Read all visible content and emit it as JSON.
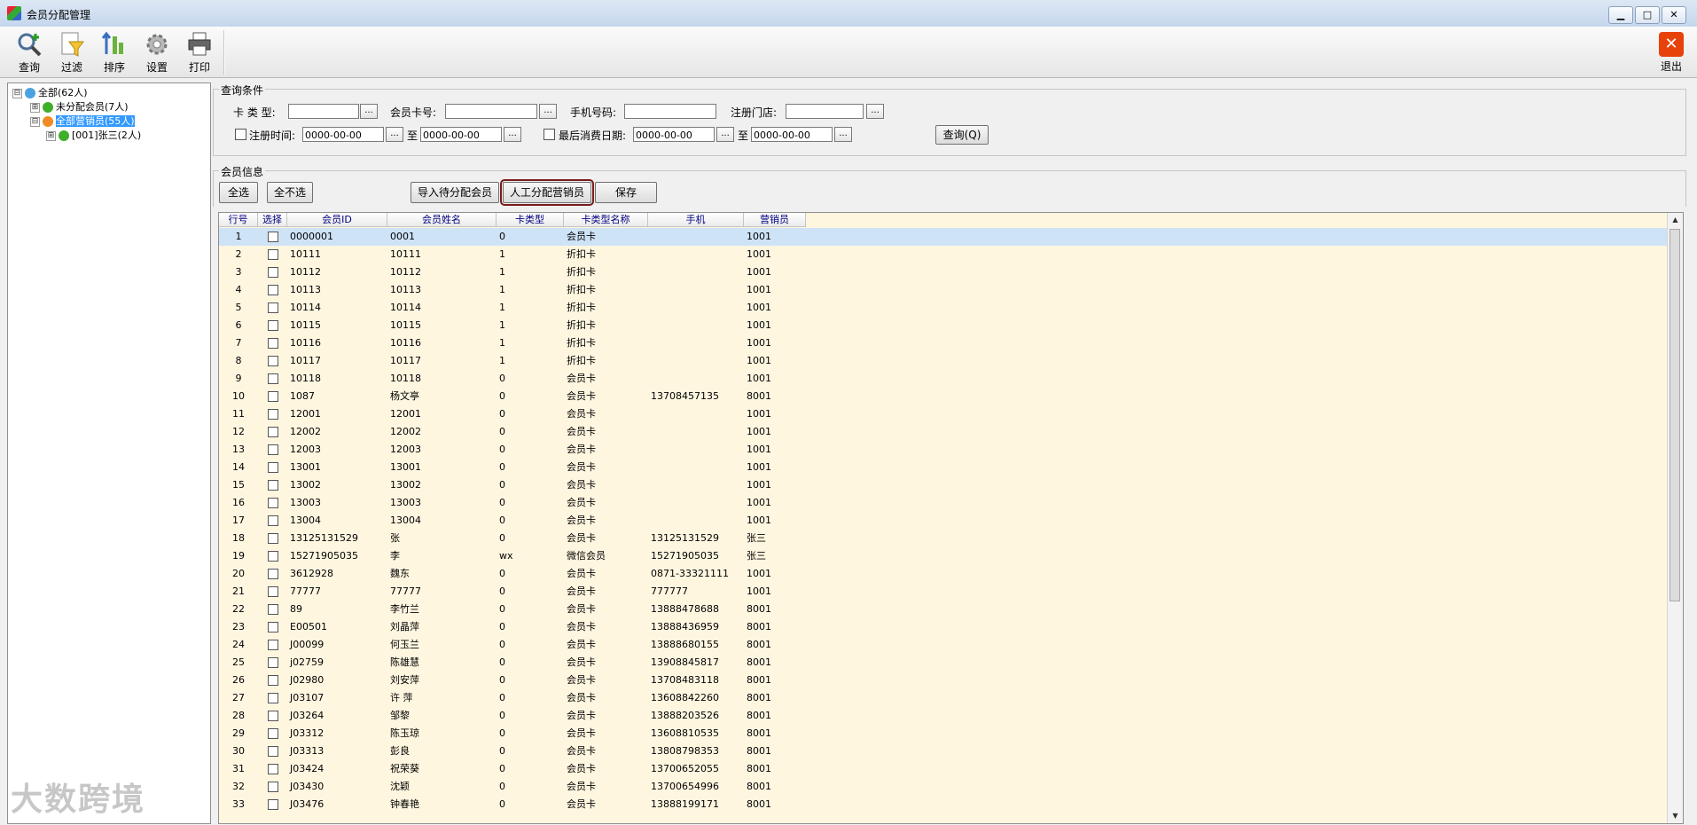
{
  "window": {
    "title": "会员分配管理",
    "min_label": "▁",
    "max_label": "□",
    "close_label": "✕"
  },
  "toolbar": {
    "query": "查询",
    "filter": "过滤",
    "sort": "排序",
    "settings": "设置",
    "print": "打印",
    "exit": "退出",
    "exit_icon": "✕"
  },
  "tree": {
    "root": "全部(62人)",
    "unassigned": "未分配会员(7人)",
    "all_sales": "全部营销员(55人)",
    "salesperson": "[001]张三(2人)"
  },
  "query": {
    "group_title": "查询条件",
    "card_type_label": "卡 类 型:",
    "card_no_label": "会员卡号:",
    "phone_label": "手机号码:",
    "store_label": "注册门店:",
    "reg_time_label": "注册时间:",
    "reg_from": "0000-00-00",
    "to_label": "至",
    "reg_to": "0000-00-00",
    "last_consume_label": "最后消费日期:",
    "consume_from": "0000-00-00",
    "consume_to": "0000-00-00",
    "dots": "...",
    "query_button": "查询(Q)"
  },
  "members": {
    "group_title": "会员信息",
    "select_all": "全选",
    "select_none": "全不选",
    "import_pending": "导入待分配会员",
    "manual_assign": "人工分配营销员",
    "save": "保存"
  },
  "grid": {
    "columns": [
      "行号",
      "选择",
      "会员ID",
      "会员姓名",
      "卡类型",
      "卡类型名称",
      "手机",
      "营销员"
    ],
    "rows": [
      [
        "1",
        "0000001",
        "0001",
        "0",
        "会员卡",
        "",
        "1001"
      ],
      [
        "2",
        "10111",
        "10111",
        "1",
        "折扣卡",
        "",
        "1001"
      ],
      [
        "3",
        "10112",
        "10112",
        "1",
        "折扣卡",
        "",
        "1001"
      ],
      [
        "4",
        "10113",
        "10113",
        "1",
        "折扣卡",
        "",
        "1001"
      ],
      [
        "5",
        "10114",
        "10114",
        "1",
        "折扣卡",
        "",
        "1001"
      ],
      [
        "6",
        "10115",
        "10115",
        "1",
        "折扣卡",
        "",
        "1001"
      ],
      [
        "7",
        "10116",
        "10116",
        "1",
        "折扣卡",
        "",
        "1001"
      ],
      [
        "8",
        "10117",
        "10117",
        "1",
        "折扣卡",
        "",
        "1001"
      ],
      [
        "9",
        "10118",
        "10118",
        "0",
        "会员卡",
        "",
        "1001"
      ],
      [
        "10",
        "1087",
        "杨文亭",
        "0",
        "会员卡",
        "13708457135",
        "8001"
      ],
      [
        "11",
        "12001",
        "12001",
        "0",
        "会员卡",
        "",
        "1001"
      ],
      [
        "12",
        "12002",
        "12002",
        "0",
        "会员卡",
        "",
        "1001"
      ],
      [
        "13",
        "12003",
        "12003",
        "0",
        "会员卡",
        "",
        "1001"
      ],
      [
        "14",
        "13001",
        "13001",
        "0",
        "会员卡",
        "",
        "1001"
      ],
      [
        "15",
        "13002",
        "13002",
        "0",
        "会员卡",
        "",
        "1001"
      ],
      [
        "16",
        "13003",
        "13003",
        "0",
        "会员卡",
        "",
        "1001"
      ],
      [
        "17",
        "13004",
        "13004",
        "0",
        "会员卡",
        "",
        "1001"
      ],
      [
        "18",
        "13125131529",
        "张",
        "0",
        "会员卡",
        "13125131529",
        "张三"
      ],
      [
        "19",
        "15271905035",
        "李",
        "wx",
        "微信会员",
        "15271905035",
        "张三"
      ],
      [
        "20",
        "3612928",
        "魏东",
        "0",
        "会员卡",
        "0871-33321111",
        "1001"
      ],
      [
        "21",
        "77777",
        "77777",
        "0",
        "会员卡",
        "777777",
        "1001"
      ],
      [
        "22",
        "89",
        "李竹兰",
        "0",
        "会员卡",
        "13888478688",
        "8001"
      ],
      [
        "23",
        "E00501",
        "刘晶萍",
        "0",
        "会员卡",
        "13888436959",
        "8001"
      ],
      [
        "24",
        "J00099",
        "何玉兰",
        "0",
        "会员卡",
        "13888680155",
        "8001"
      ],
      [
        "25",
        "j02759",
        "陈雄慧",
        "0",
        "会员卡",
        "13908845817",
        "8001"
      ],
      [
        "26",
        "J02980",
        "刘安萍",
        "0",
        "会员卡",
        "13708483118",
        "8001"
      ],
      [
        "27",
        "J03107",
        "许 萍",
        "0",
        "会员卡",
        "13608842260",
        "8001"
      ],
      [
        "28",
        "J03264",
        "邹黎",
        "0",
        "会员卡",
        "13888203526",
        "8001"
      ],
      [
        "29",
        "J03312",
        "陈玉琼",
        "0",
        "会员卡",
        "13608810535",
        "8001"
      ],
      [
        "30",
        "J03313",
        "彭良",
        "0",
        "会员卡",
        "13808798353",
        "8001"
      ],
      [
        "31",
        "J03424",
        "祝荣葵",
        "0",
        "会员卡",
        "13700652055",
        "8001"
      ],
      [
        "32",
        "J03430",
        "沈颖",
        "0",
        "会员卡",
        "13700654996",
        "8001"
      ],
      [
        "33",
        "J03476",
        "钟春艳",
        "0",
        "会员卡",
        "13888199171",
        "8001"
      ]
    ]
  },
  "watermark": "大数跨境",
  "scroll": {
    "up": "▲",
    "down": "▼"
  },
  "icons": {
    "expand": "⊟",
    "collapse": "⊞",
    "node_green": "#3fae2a",
    "node_orange": "#f08a24",
    "node_blue": "#4aa3df"
  },
  "colors": {
    "grid_bg": "#fff6e0",
    "selected_row": "#cfe3f7",
    "header_text": "#000080",
    "tree_selected": "#3399ff"
  }
}
